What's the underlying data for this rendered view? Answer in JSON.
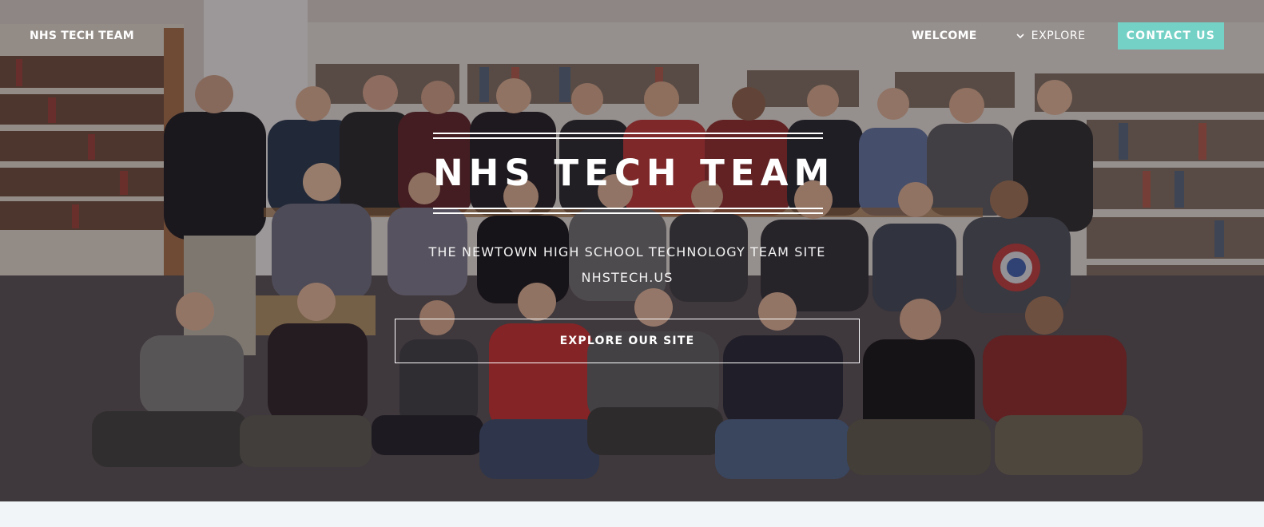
{
  "nav": {
    "brand": "NHS TECH TEAM",
    "welcome": "WELCOME",
    "explore": "EXPLORE",
    "contact": "CONTACT US"
  },
  "hero": {
    "title": "NHS TECH TEAM",
    "subtitle": "THE NEWTOWN HIGH SCHOOL TECHNOLOGY TEAM SITE",
    "site": "NHSTECH.US",
    "cta": "EXPLORE OUR SITE",
    "image": "team-group-photo-in-library"
  },
  "colors": {
    "accent": "#74d1c6",
    "text": "#ffffff"
  },
  "icons": {
    "explore_dropdown": "chevron-down-icon"
  }
}
